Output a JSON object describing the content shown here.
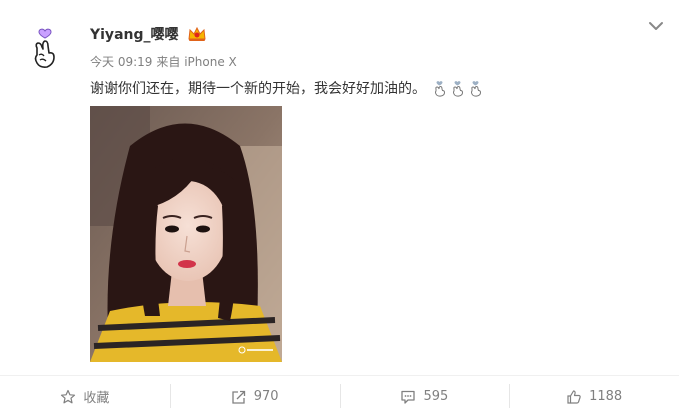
{
  "post": {
    "author": "Yiyang_嘤嘤",
    "time": "今天 09:19",
    "source": "来自 iPhone X",
    "text": "谢谢你们还在，期待一个新的开始，我会好好加油的。",
    "emoji_count": 3
  },
  "actions": {
    "favorite_label": "收藏",
    "repost_count": "970",
    "comment_count": "595",
    "like_count": "1188"
  },
  "icons": {
    "avatar": "finger-heart-icon",
    "badge": "crown-vip-icon",
    "more": "chevron-down-icon",
    "emoji": "finger-heart-icon",
    "favorite": "star-icon",
    "repost": "share-arrow-icon",
    "comment": "comment-icon",
    "like": "thumbs-up-icon"
  }
}
